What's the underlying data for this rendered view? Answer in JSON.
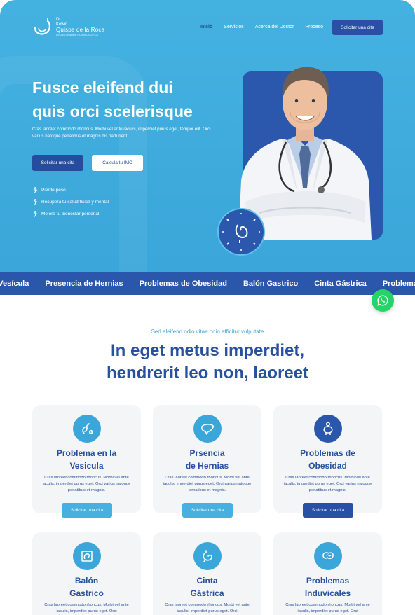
{
  "brand": {
    "line1": "Dr.",
    "line2": "Kewin",
    "line3": "Quispe de la Roca",
    "line4": "CIRUGÍA GENERAL Y LAPAROSCÓPICA"
  },
  "nav": {
    "items": [
      {
        "label": "Inicio",
        "active": true
      },
      {
        "label": "Servicios"
      },
      {
        "label": "Acerca del Doctor"
      },
      {
        "label": "Proceso"
      }
    ],
    "cta": "Solicitar una cita"
  },
  "hero": {
    "title_line1": "Fusce eleifend dui",
    "title_line2": "quis orci scelerisque",
    "description": "Cras laoreet commodo rhoncus. Morbi vel ante iaculis, imperdiet purus eget, tempor elit. Orci varius natoque penatibus et magnis dis parturient.",
    "btn_primary": "Solicitar una cita",
    "btn_secondary": "Calcula tu IMC",
    "benefits": [
      "Pierde peso",
      "Recupera tu salud física y mental",
      "Mejora tu bienestar personal"
    ],
    "stamp_text": "Doctor Kewin · Doctor Kewin ·"
  },
  "ticker": {
    "items": [
      "Problema en la Vesícula",
      "Presencia de Hernias",
      "Problemas  de Obesidad",
      "Balón Gastrico",
      "Cinta Gástrica",
      "Problemas Inducidos"
    ]
  },
  "section": {
    "kicker": "Sed eleifend odio vitae odio efficitur vulputate",
    "title_line1": "In eget metus imperdiet,",
    "title_line2": "hendrerit leo non, laoreet"
  },
  "cards": [
    {
      "title1": "Problema en la",
      "title2": "Vesicula",
      "desc": "Cras laoreet commodo rhoncus. Morbi vel ante iaculis, imperdiet purus eget. Orci varius natoque penatibus et magnis.",
      "button": "Solicitar una cita",
      "icon": "gallbladder-icon"
    },
    {
      "title1": "Prsencia",
      "title2": "de Hernias",
      "desc": "Cras laoreet commodo rhoncus. Morbi vel ante iaculis, imperdiet purus eget. Orci varius natoque penatibus et magnis.",
      "button": "Solicitar una cita",
      "icon": "liver-icon"
    },
    {
      "title1": "Problemas de",
      "title2": "Obesidad",
      "desc": "Cras laoreet commodo rhoncus. Morbi vel ante iaculis, imperdiet purus eget. Orci varius natoque penatibus et magnis.",
      "button": "Solicitar una cita",
      "icon": "body-icon"
    },
    {
      "title1": "Balón",
      "title2": "Gastrico",
      "desc": "Cras laoreet commodo rhoncus. Morbi vel ante iaculis, imperdiet purus eget. Orci",
      "icon": "balloon-icon"
    },
    {
      "title1": "Cinta",
      "title2": "Gástrica",
      "desc": "Cras laoreet commodo rhoncus. Morbi vel ante iaculis, imperdiet purus eget. Orci",
      "icon": "stomach-icon"
    },
    {
      "title1": "Problemas",
      "title2": "Induvicales",
      "desc": "Cras laoreet commodo rhoncus. Morbi vel ante iaculis, imperdiet purus eget. Orci",
      "icon": "intestine-icon"
    }
  ],
  "colors": {
    "hero_bg": "#44b2e1",
    "brand_blue": "#2a57ab",
    "card_bg": "#f4f5f7",
    "whatsapp": "#25d366"
  }
}
